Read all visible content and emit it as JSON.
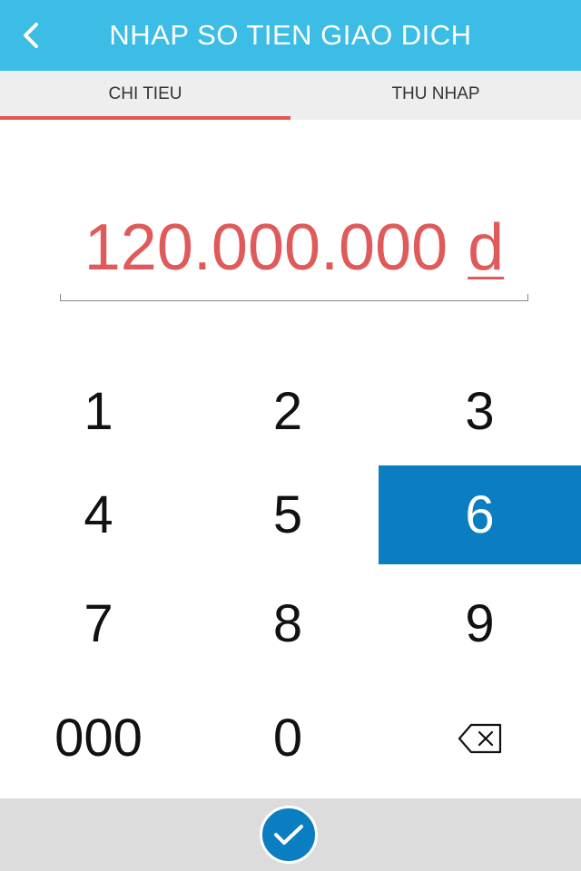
{
  "header": {
    "title": "NHAP SO TIEN GIAO DICH",
    "back_icon": "chevron-left-icon"
  },
  "tabs": [
    {
      "label": "CHI TIEU",
      "active": true
    },
    {
      "label": "THU NHAP",
      "active": false
    }
  ],
  "amount": {
    "value": "120.000.000",
    "currency": "d"
  },
  "keypad": {
    "keys": [
      "1",
      "2",
      "3",
      "4",
      "5",
      "6",
      "7",
      "8",
      "9",
      "000",
      "0"
    ],
    "active_key": "6",
    "backspace_icon": "backspace-icon"
  },
  "footer": {
    "confirm_icon": "checkmark-icon"
  },
  "colors": {
    "header": "#3bbde6",
    "accent_red": "#df5b5b",
    "active_key": "#0a7ec0",
    "footer": "#dcdcdc"
  }
}
